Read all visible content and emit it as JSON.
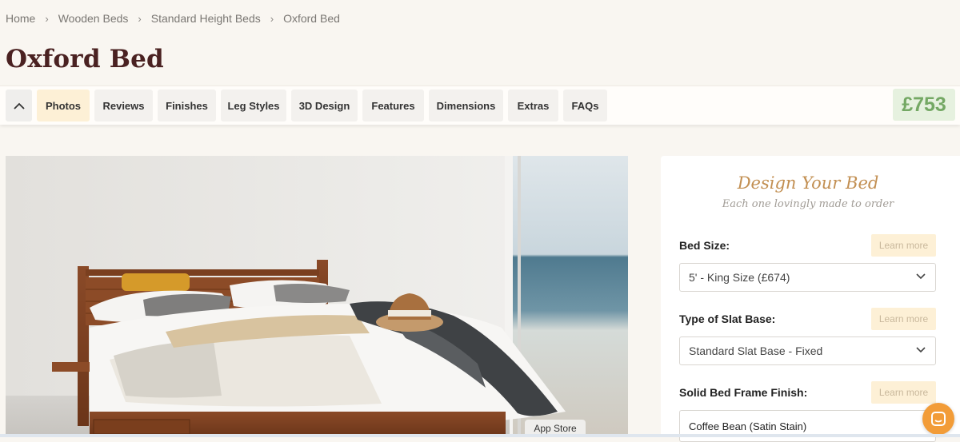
{
  "breadcrumb": {
    "items": [
      "Home",
      "Wooden Beds",
      "Standard Height Beds",
      "Oxford Bed"
    ]
  },
  "title": "Oxford Bed",
  "nav": {
    "tabs": [
      "Photos",
      "Reviews",
      "Finishes",
      "Leg Styles",
      "3D Design",
      "Features",
      "Dimensions",
      "Extras",
      "FAQs"
    ],
    "active_tab": "Photos",
    "price": "£753"
  },
  "photo": {
    "overlay_label": "App Store"
  },
  "design": {
    "title": "Design Your Bed",
    "subtitle": "Each one lovingly made to order",
    "learn_more": "Learn more",
    "fields": [
      {
        "label": "Bed Size:",
        "value": "5' - King Size (£674)"
      },
      {
        "label": "Type of Slat Base:",
        "value": "Standard Slat Base - Fixed"
      },
      {
        "label": "Solid Bed Frame Finish:",
        "value": "Coffee Bean (Satin Stain)"
      }
    ]
  },
  "colors": {
    "accent": "#c28f52",
    "title": "#4a2121",
    "price": "#74a864",
    "chat": "#f29c38"
  },
  "icons": [
    "chevron-right-icon",
    "chevron-up-icon",
    "chevron-down-icon",
    "chat-icon"
  ]
}
